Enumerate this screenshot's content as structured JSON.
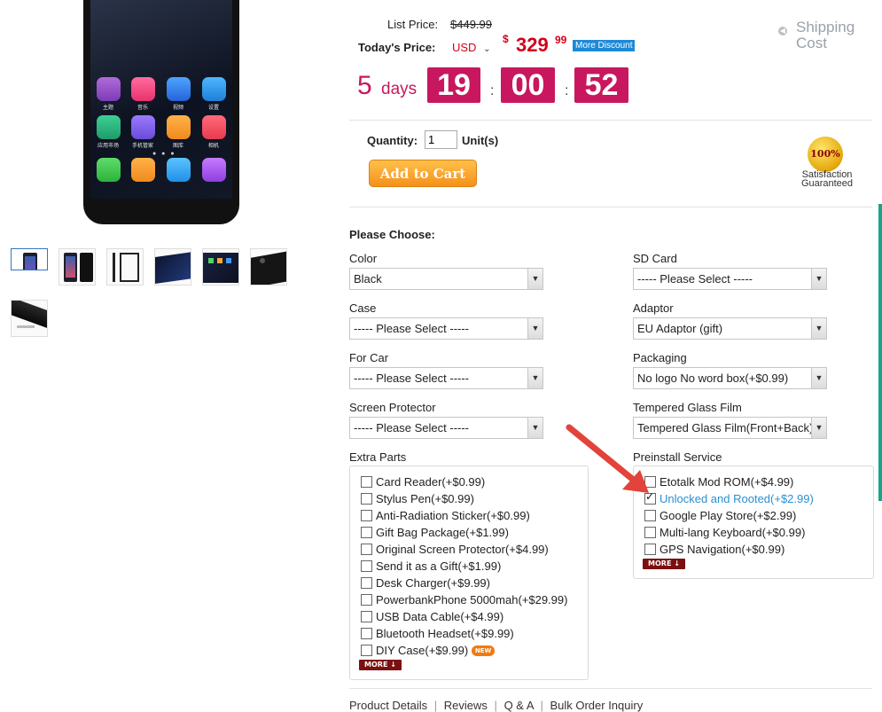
{
  "gallery": {
    "thumbnails": [
      "front view",
      "front and back",
      "side view",
      "dark screen",
      "home screen",
      "rear camera",
      "side edge"
    ],
    "app_labels": [
      "主题",
      "音乐",
      "视频",
      "设置",
      "应用市场",
      "手机管家",
      "图库",
      "相机"
    ]
  },
  "price": {
    "list_label": "List Price:",
    "list_value": "$449.99",
    "today_label": "Today's Price:",
    "currency": "USD",
    "dollar_sign": "$",
    "amount": "329",
    "cents": "99",
    "discount_badge": "More Discount",
    "shipping": "Shipping Cost"
  },
  "countdown": {
    "days_num": "5",
    "days_word": "days",
    "hours": "19",
    "minutes": "00",
    "seconds": "52"
  },
  "cart": {
    "quantity_label": "Quantity:",
    "quantity_value": "1",
    "unit": "Unit(s)",
    "add_button": "Add to Cart"
  },
  "seal": {
    "badge": "100%",
    "line1": "Satisfaction",
    "line2": "Guaranteed"
  },
  "options": {
    "heading": "Please Choose:",
    "color": {
      "label": "Color",
      "value": "Black"
    },
    "case": {
      "label": "Case",
      "value": "----- Please Select -----"
    },
    "for_car": {
      "label": "For Car",
      "value": "----- Please Select -----"
    },
    "screen_protector": {
      "label": "Screen Protector",
      "value": "----- Please Select -----"
    },
    "sd_card": {
      "label": "SD Card",
      "value": "----- Please Select -----"
    },
    "adaptor": {
      "label": "Adaptor",
      "value": "EU Adaptor (gift)"
    },
    "packaging": {
      "label": "Packaging",
      "value": "No logo No word box(+$0.99)"
    },
    "tempered_glass": {
      "label": "Tempered Glass Film",
      "value": "Tempered Glass Film(Front+Back)"
    }
  },
  "extra_parts": {
    "label": "Extra Parts",
    "items": [
      "Card Reader(+$0.99)",
      "Stylus Pen(+$0.99)",
      "Anti-Radiation Sticker(+$0.99)",
      "Gift Bag Package(+$1.99)",
      "Original Screen Protector(+$4.99)",
      "Send it as a Gift(+$1.99)",
      "Desk Charger(+$9.99)",
      "PowerbankPhone 5000mah(+$29.99)",
      "USB Data Cable(+$4.99)",
      "Bluetooth Headset(+$9.99)",
      "DIY Case(+$9.99)"
    ],
    "new_badge": "NEW",
    "more": "MORE"
  },
  "preinstall": {
    "label": "Preinstall Service",
    "items": [
      "Etotalk Mod ROM(+$4.99)",
      "Unlocked and Rooted(+$2.99)",
      "Google Play Store(+$2.99)",
      "Multi-lang Keyboard(+$0.99)",
      "GPS Navigation(+$0.99)"
    ],
    "checked_index": 1,
    "more": "MORE"
  },
  "tabs": [
    "Product Details",
    "Reviews",
    "Q & A",
    "Bulk Order Inquiry"
  ],
  "colors": {
    "accent": "#c8175e",
    "price_red": "#d0021b",
    "button_orange": "#f5901b",
    "link_blue": "#2a8fd1",
    "arrow_red": "#e2433a"
  }
}
